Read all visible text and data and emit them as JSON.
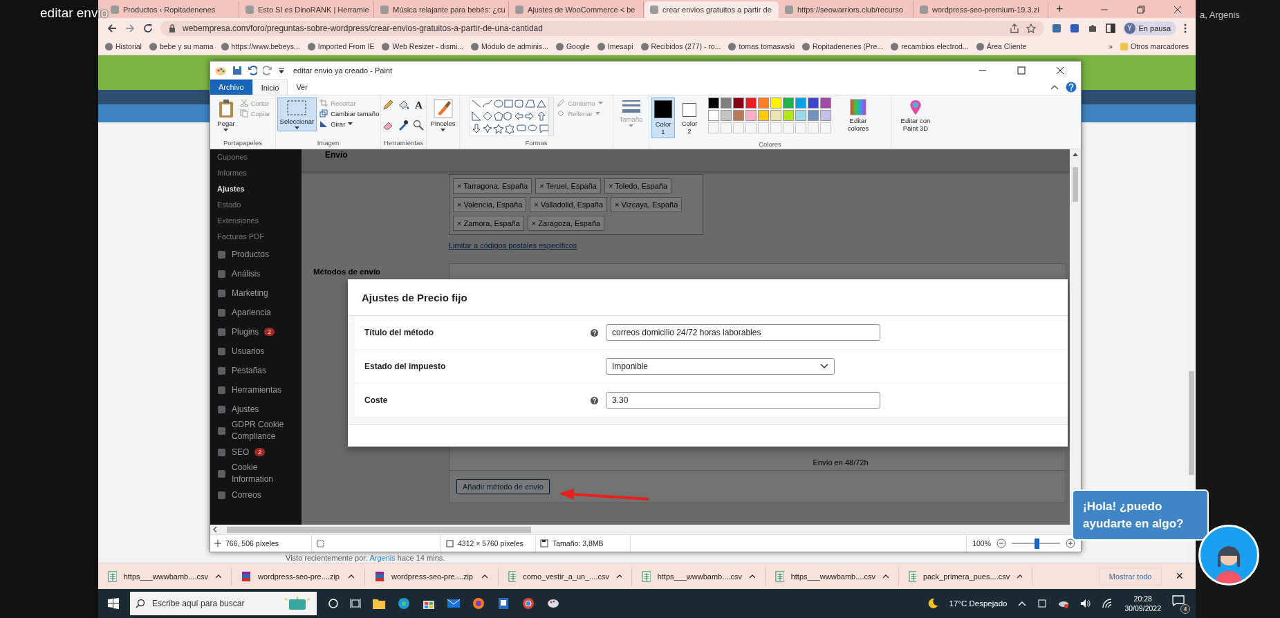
{
  "overlay_title": "editar envio",
  "corner_text": "a, Argenis",
  "browser": {
    "tabs": [
      {
        "title": "Productos ‹ Ropitadenenes",
        "selected": false
      },
      {
        "title": "Esto SI es DinoRANK | Herramie",
        "selected": false
      },
      {
        "title": "Música relajante para bebés: ¿cu",
        "selected": false
      },
      {
        "title": "Ajustes de WooCommerce < be",
        "selected": false
      },
      {
        "title": "crear envios gratuitos a partir de",
        "selected": true
      },
      {
        "title": "https://seowarriors.club/recurso",
        "selected": false
      },
      {
        "title": "wordpress-seo-premium-19.3.zi",
        "selected": false
      }
    ],
    "new_tab": "+",
    "url": "webempresa.com/foro/preguntas-sobre-wordpress/crear-envios-gratuitos-a-partir-de-una-cantidad",
    "profile_initial": "Y",
    "profile_status": "En pausa",
    "bookmarks": [
      "Historial",
      "bebe y su mama",
      "https://www.bebeys...",
      "Imported From IE",
      "Web Resizer - dismi...",
      "Módulo de adminis...",
      "Google",
      "Imesapi",
      "Recibidos (277) - ro...",
      "tomas tomaswski",
      "Ropitadenenes (Pre...",
      "recambios electrod...",
      "Área Cliente"
    ],
    "more_bookmarks": "»",
    "other_bookmarks": "Otros marcadores"
  },
  "page": {
    "seen_prefix": "Visto recientemente por:",
    "seen_user": "Argenis",
    "seen_suffix": "hace 14 mins."
  },
  "paint": {
    "title": "editar envio ya creado - Paint",
    "ribbon_tabs": [
      {
        "label": "Archivo",
        "kind": "file",
        "selected": false
      },
      {
        "label": "Inicio",
        "kind": "tab",
        "selected": true
      },
      {
        "label": "Ver",
        "kind": "tab",
        "selected": false
      }
    ],
    "clipboard": {
      "paste": "Pegar",
      "cut": "Cortar",
      "copy": "Copiar",
      "group": "Portapapeles"
    },
    "image": {
      "select": "Seleccionar",
      "crop": "Recortar",
      "resize": "Cambiar tamaño",
      "rotate": "Girar",
      "group": "Imagen"
    },
    "tools": {
      "text_glyph": "A",
      "group": "Herramientas"
    },
    "brushes": "Pinceles",
    "shapes": {
      "outline": "Contorno",
      "fill": "Rellenar",
      "group": "Formas"
    },
    "size": "Tamaño",
    "colors": {
      "slots": [
        {
          "label": "Color 1",
          "color": "#000000",
          "selected": true
        },
        {
          "label": "Color 2",
          "color": "#ffffff",
          "selected": false
        }
      ],
      "palette": [
        {
          "color": "#000000"
        },
        {
          "color": "#7f7f7f"
        },
        {
          "color": "#880015"
        },
        {
          "color": "#ed1c24"
        },
        {
          "color": "#ff7f27"
        },
        {
          "color": "#fff200"
        },
        {
          "color": "#22b14c"
        },
        {
          "color": "#00a2e8"
        },
        {
          "color": "#3f48cc"
        },
        {
          "color": "#a349a4"
        },
        {
          "color": "#ffffff"
        },
        {
          "color": "#c3c3c3"
        },
        {
          "color": "#b97a57"
        },
        {
          "color": "#ffaec9"
        },
        {
          "color": "#ffc90e"
        },
        {
          "color": "#efe4b0"
        },
        {
          "color": "#b5e61d"
        },
        {
          "color": "#99d9ea"
        },
        {
          "color": "#7092be"
        },
        {
          "color": "#c8bfe7"
        }
      ],
      "edit_colors": "Editar colores",
      "group": "Colores"
    },
    "paint3d": "Editar con Paint 3D",
    "status": {
      "cursor": "766, 506 píxeles",
      "dimensions": "4312 × 5760 píxeles",
      "file_size": "Tamaño: 3,8MB",
      "zoom": "100%",
      "zoom_slider": {
        "level": 0.52
      }
    }
  },
  "wp": {
    "sidebar": [
      {
        "label": "Cupones",
        "kind": "sub",
        "current": false
      },
      {
        "label": "Informes",
        "kind": "sub",
        "current": false
      },
      {
        "label": "Ajustes",
        "kind": "sub",
        "current": true
      },
      {
        "label": "Estado",
        "kind": "sub",
        "current": false
      },
      {
        "label": "Extensiones",
        "kind": "sub",
        "current": false
      },
      {
        "label": "Facturas PDF",
        "kind": "sub",
        "current": false
      },
      {
        "label": "Productos",
        "kind": "menu",
        "current": false
      },
      {
        "label": "Análisis",
        "kind": "menu",
        "current": false
      },
      {
        "label": "Marketing",
        "kind": "menu",
        "current": false
      },
      {
        "label": "Apariencia",
        "kind": "menu",
        "current": false
      },
      {
        "label": "Plugins",
        "kind": "menu",
        "current": false,
        "badge": "2"
      },
      {
        "label": "Usuarios",
        "kind": "menu",
        "current": false
      },
      {
        "label": "Pestañas",
        "kind": "menu",
        "current": false
      },
      {
        "label": "Herramientas",
        "kind": "menu",
        "current": false
      },
      {
        "label": "Ajustes",
        "kind": "menu",
        "current": false
      },
      {
        "label": "GDPR Cookie Compliance",
        "kind": "menu",
        "current": false
      },
      {
        "label": "SEO",
        "kind": "menu",
        "current": false,
        "badge": "2"
      },
      {
        "label": "Cookie Information",
        "kind": "menu",
        "current": false
      },
      {
        "label": "Correos",
        "kind": "menu",
        "current": false
      }
    ],
    "section_heading": "Envío",
    "region_tags": [
      {
        "x": "×",
        "label": "Tarragona, España"
      },
      {
        "x": "×",
        "label": "Teruel, España"
      },
      {
        "x": "×",
        "label": "Toledo, España"
      },
      {
        "x": "×",
        "label": "Valencia, España"
      },
      {
        "x": "×",
        "label": "Valladolid, España"
      },
      {
        "x": "×",
        "label": "Vizcaya, España"
      },
      {
        "x": "×",
        "label": "Zamora, España"
      },
      {
        "x": "×",
        "label": "Zaragoza, España"
      }
    ],
    "zip_link": "Limitar a códigos postales específicos",
    "methods_label": "Métodos de envío",
    "method_description": "Envío en 48/72h",
    "add_method": "Añadir método de envío",
    "modal": {
      "title": "Ajustes de Precio fijo",
      "fields": [
        {
          "label": "Título del método",
          "kind": "text",
          "help": true,
          "value": "correos domicilio 24/72 horas laborables"
        },
        {
          "label": "Estado del impuesto",
          "kind": "select",
          "help": false,
          "value": "Imponible"
        },
        {
          "label": "Coste",
          "kind": "text",
          "help": true,
          "value": "3.30"
        }
      ]
    }
  },
  "downloads": {
    "items": [
      {
        "name": "https___wwwbamb....csv",
        "kind": "csv"
      },
      {
        "name": "wordpress-seo-pre....zip",
        "kind": "zip"
      },
      {
        "name": "wordpress-seo-pre....zip",
        "kind": "zip"
      },
      {
        "name": "como_vestir_a_un_....csv",
        "kind": "csv"
      },
      {
        "name": "https___wwwbamb....csv",
        "kind": "csv"
      },
      {
        "name": "https___wwwbamb....csv",
        "kind": "csv"
      },
      {
        "name": "pack_primera_pues....csv",
        "kind": "csv"
      }
    ],
    "show_all": "Mostrar todo",
    "close": "×"
  },
  "taskbar": {
    "search_placeholder": "Escribe aquí para buscar",
    "weather": "17°C Despejado",
    "time": "20:28",
    "date": "30/09/2022",
    "notifications": "4"
  },
  "chat_bubble": "¡Hola! ¿puedo ayudarte en algo?"
}
